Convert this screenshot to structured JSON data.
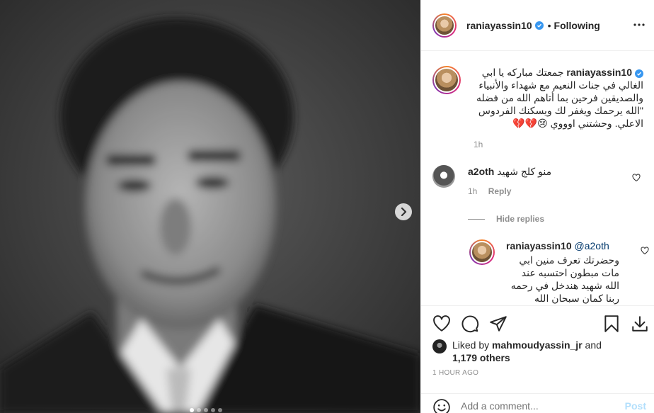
{
  "colors": {
    "accent": "#0095f6",
    "verified": "#3897f0",
    "muted": "#8e8e8e",
    "post_disabled": "#b2dffc"
  },
  "media": {
    "carousel_pages": 5,
    "active_page": 1
  },
  "header": {
    "username": "raniayassin10",
    "separator": "•",
    "follow_status": "Following"
  },
  "caption": {
    "username": "raniayassin10",
    "text": "جمعتك مباركه يا ابي الغالي في جنات النعيم مع شهداء والأنبياء والصديقين فرحين بما أتاهم الله من فضله \"الله يرحمك ويغفر لك ويسكنك الفردوس الاعلي. وحشتني اوووي 😢💔💔",
    "time": "1h"
  },
  "comments": [
    {
      "username": "a2oth",
      "text": "منو كلج شهيد",
      "time": "1h",
      "reply_label": "Reply",
      "hide_replies_label": "Hide replies"
    }
  ],
  "reply": {
    "username": "raniayassin10",
    "mention": "@a2oth",
    "text": "وحضرتك تعرف منين ابي مات مبطون احتسبه عند الله شهيد هندخل في رحمه ربنا كمان سبحان الله"
  },
  "likes": {
    "prefix": "Liked by",
    "user": "mahmoudyassin_jr",
    "and": "and",
    "others": "1,179 others"
  },
  "timestamp": "1 HOUR AGO",
  "add_comment": {
    "placeholder": "Add a comment...",
    "post_label": "Post"
  },
  "icons": [
    "chevron-right-icon",
    "more-icon",
    "verified-icon",
    "heart-icon",
    "comment-icon",
    "share-icon",
    "bookmark-icon",
    "download-icon",
    "emoji-icon"
  ]
}
